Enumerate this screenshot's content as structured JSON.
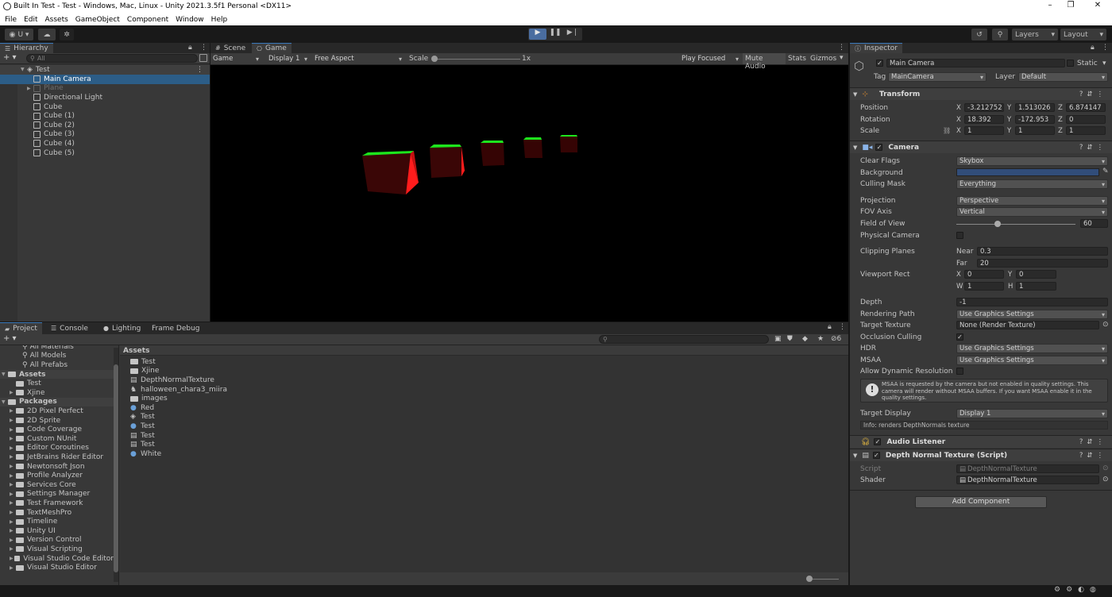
{
  "window": {
    "title": "Built In Test - Test - Windows, Mac, Linux - Unity 2021.3.5f1 Personal <DX11>",
    "minimize": "–",
    "maximize": "❐",
    "close": "✕"
  },
  "menu": [
    "File",
    "Edit",
    "Assets",
    "GameObject",
    "Component",
    "Window",
    "Help"
  ],
  "toolbar": {
    "account": "U ▾",
    "layers": "Layers",
    "layout": "Layout"
  },
  "hierarchy": {
    "tab": "Hierarchy",
    "search_placeholder": "All",
    "scene": "Test",
    "items": [
      {
        "label": "Main Camera",
        "selected": true
      },
      {
        "label": "Plane",
        "disabled": true
      },
      {
        "label": "Directional Light"
      },
      {
        "label": "Cube"
      },
      {
        "label": "Cube (1)"
      },
      {
        "label": "Cube (2)"
      },
      {
        "label": "Cube (3)"
      },
      {
        "label": "Cube (4)"
      },
      {
        "label": "Cube (5)"
      }
    ]
  },
  "game": {
    "tabs": [
      "Scene",
      "Game"
    ],
    "display_mode": "Game",
    "display": "Display 1",
    "aspect": "Free Aspect",
    "scale_label": "Scale",
    "scale_value": "1x",
    "play_focused": "Play Focused",
    "mute_audio": "Mute Audio",
    "stats": "Stats",
    "gizmos": "Gizmos"
  },
  "project": {
    "tabs": [
      "Project",
      "Console",
      "Lighting",
      "Frame Debug"
    ],
    "add": "+ ▾",
    "favorites": [
      "All Materials",
      "All Models",
      "All Prefabs"
    ],
    "assets_root": "Assets",
    "asset_folders": [
      "Test",
      "Xjine"
    ],
    "packages_root": "Packages",
    "packages": [
      "2D Pixel Perfect",
      "2D Sprite",
      "Code Coverage",
      "Custom NUnit",
      "Editor Coroutines",
      "JetBrains Rider Editor",
      "Newtonsoft Json",
      "Profile Analyzer",
      "Services Core",
      "Settings Manager",
      "Test Framework",
      "TextMeshPro",
      "Timeline",
      "Unity UI",
      "Version Control",
      "Visual Scripting",
      "Visual Studio Code Editor",
      "Visual Studio Editor"
    ],
    "breadcrumb": "Assets",
    "files": [
      {
        "label": "Test",
        "icon": "folder"
      },
      {
        "label": "Xjine",
        "icon": "folder"
      },
      {
        "label": "DepthNormalTexture",
        "icon": "script"
      },
      {
        "label": "halloween_chara3_miira",
        "icon": "model"
      },
      {
        "label": "images",
        "icon": "folder"
      },
      {
        "label": "Red",
        "icon": "material"
      },
      {
        "label": "Test",
        "icon": "scene"
      },
      {
        "label": "Test",
        "icon": "material"
      },
      {
        "label": "Test",
        "icon": "shader"
      },
      {
        "label": "Test",
        "icon": "script"
      },
      {
        "label": "White",
        "icon": "material"
      }
    ],
    "hidden_count": "6"
  },
  "inspector": {
    "tab": "Inspector",
    "object_name": "Main Camera",
    "static_label": "Static",
    "tag_label": "Tag",
    "tag": "MainCamera",
    "layer_label": "Layer",
    "layer": "Default",
    "transform": {
      "title": "Transform",
      "position_label": "Position",
      "position": [
        "-3.212752",
        "1.513026",
        "6.874147"
      ],
      "rotation_label": "Rotation",
      "rotation": [
        "18.392",
        "-172.953",
        "0"
      ],
      "scale_label": "Scale",
      "scale": [
        "1",
        "1",
        "1"
      ]
    },
    "camera": {
      "title": "Camera",
      "clear_flags_label": "Clear Flags",
      "clear_flags": "Skybox",
      "background_label": "Background",
      "background_color": "#314d79",
      "culling_mask_label": "Culling Mask",
      "culling_mask": "Everything",
      "projection_label": "Projection",
      "projection": "Perspective",
      "fov_axis_label": "FOV Axis",
      "fov_axis": "Vertical",
      "fov_label": "Field of View",
      "fov": "60",
      "physical_label": "Physical Camera",
      "clipping_label": "Clipping Planes",
      "near_label": "Near",
      "near": "0.3",
      "far_label": "Far",
      "far": "20",
      "viewport_label": "Viewport Rect",
      "vx": "0",
      "vy": "0",
      "vw": "1",
      "vh": "1",
      "depth_label": "Depth",
      "depth": "-1",
      "rendering_path_label": "Rendering Path",
      "rendering_path": "Use Graphics Settings",
      "target_texture_label": "Target Texture",
      "target_texture": "None (Render Texture)",
      "occlusion_label": "Occlusion Culling",
      "hdr_label": "HDR",
      "hdr": "Use Graphics Settings",
      "msaa_label": "MSAA",
      "msaa": "Use Graphics Settings",
      "dynres_label": "Allow Dynamic Resolution",
      "warning": "MSAA is requested by the camera but not enabled in quality settings. This camera will render without MSAA buffers. If you want MSAA enable it in the quality settings.",
      "target_display_label": "Target Display",
      "target_display": "Display 1",
      "info": "Info: renders DepthNormals texture"
    },
    "audio_listener": {
      "title": "Audio Listener"
    },
    "depth_script": {
      "title": "Depth Normal Texture (Script)",
      "script_label": "Script",
      "script": "DepthNormalTexture",
      "shader_label": "Shader",
      "shader": "DepthNormalTexture"
    },
    "add_component": "Add Component"
  }
}
